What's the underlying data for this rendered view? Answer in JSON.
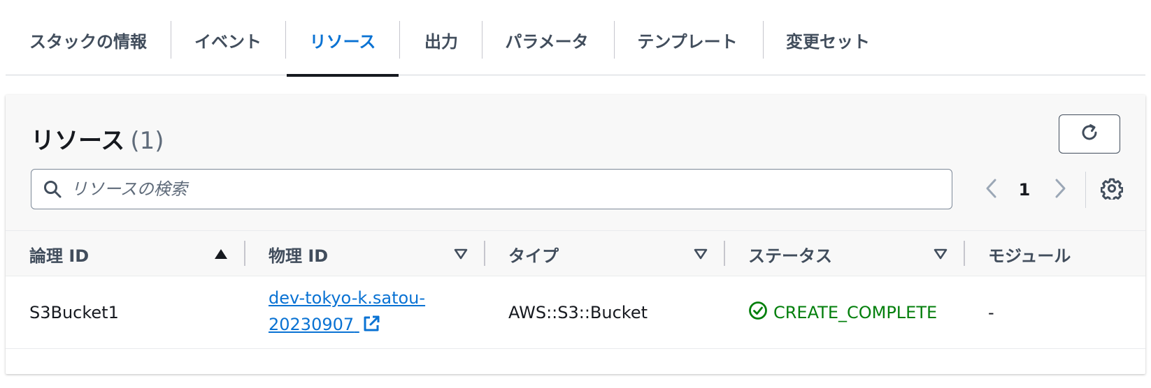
{
  "tabs": [
    {
      "label": "スタックの情報",
      "active": false
    },
    {
      "label": "イベント",
      "active": false
    },
    {
      "label": "リソース",
      "active": true
    },
    {
      "label": "出力",
      "active": false
    },
    {
      "label": "パラメータ",
      "active": false
    },
    {
      "label": "テンプレート",
      "active": false
    },
    {
      "label": "変更セット",
      "active": false
    }
  ],
  "panel": {
    "title": "リソース",
    "count": "(1)",
    "refresh_icon": "refresh-icon"
  },
  "search": {
    "placeholder": "リソースの検索",
    "icon": "search-icon"
  },
  "pagination": {
    "current_page": "1",
    "prev_icon": "chevron-left-icon",
    "next_icon": "chevron-right-icon",
    "settings_icon": "gear-icon"
  },
  "table": {
    "columns": [
      {
        "label": "論理 ID",
        "sort": "ascending"
      },
      {
        "label": "物理 ID",
        "sort": "none"
      },
      {
        "label": "タイプ",
        "sort": "none"
      },
      {
        "label": "ステータス",
        "sort": "none"
      },
      {
        "label": "モジュール",
        "sort": "none"
      }
    ],
    "rows": [
      {
        "logical_id": "S3Bucket1",
        "physical_id_line1": "dev-tokyo-k.satou-",
        "physical_id_line2": "20230907",
        "type": "AWS::S3::Bucket",
        "status": "CREATE_COMPLETE",
        "module": "-"
      }
    ]
  },
  "colors": {
    "accent": "#0972d3",
    "success": "#037f0c",
    "text": "#16191f",
    "muted": "#414d5c"
  }
}
